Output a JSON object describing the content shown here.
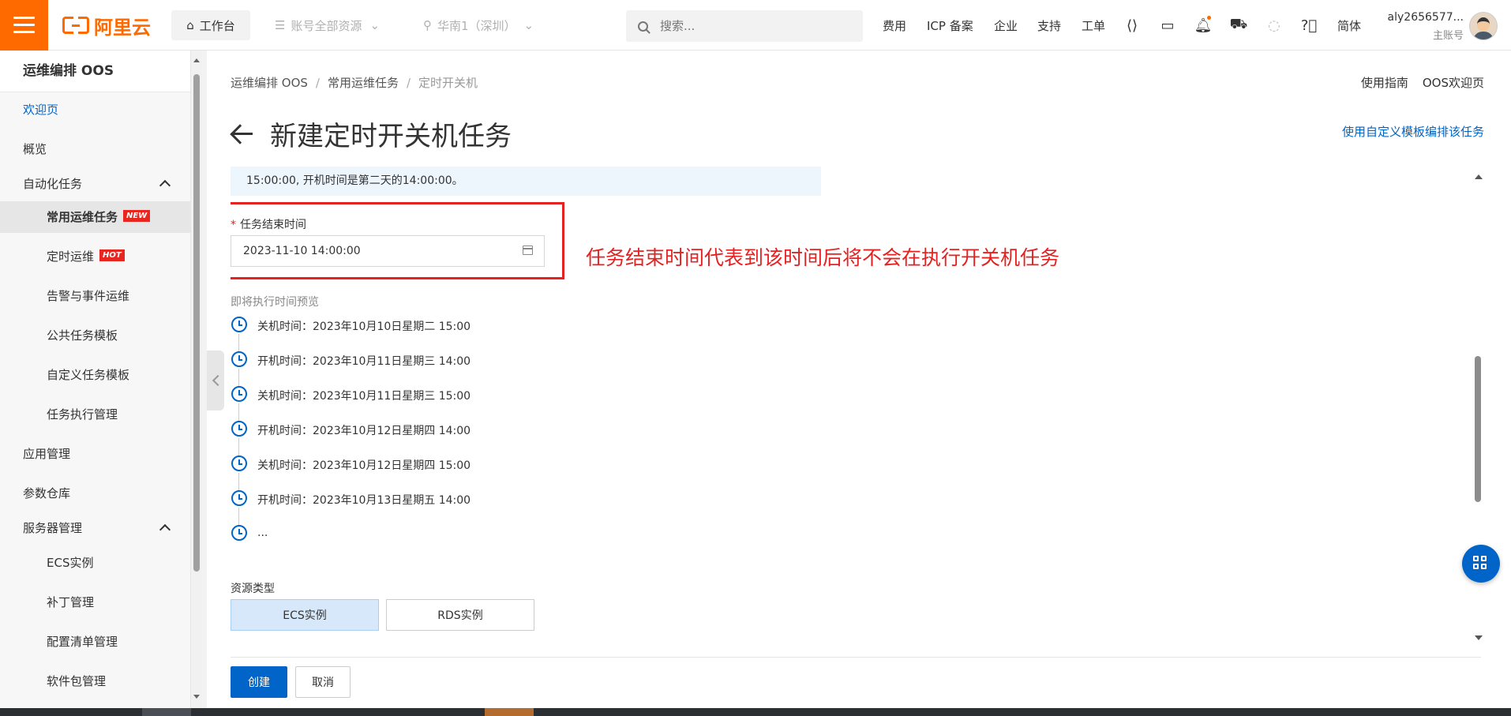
{
  "header": {
    "logo_text": "阿里云",
    "workbench": "工作台",
    "resource_group": "账号全部资源",
    "region": "华南1（深圳）",
    "search_placeholder": "搜索...",
    "links": [
      "费用",
      "ICP 备案",
      "企业",
      "支持",
      "工单"
    ],
    "language": "简体",
    "user_name": "aly2656577...",
    "user_role": "主账号"
  },
  "sidebar": {
    "title": "运维编排 OOS",
    "items": [
      {
        "label": "欢迎页"
      },
      {
        "label": "概览"
      },
      {
        "label": "自动化任务"
      },
      {
        "label": "常用运维任务",
        "badge": "NEW"
      },
      {
        "label": "定时运维",
        "badge": "HOT"
      },
      {
        "label": "告警与事件运维"
      },
      {
        "label": "公共任务模板"
      },
      {
        "label": "自定义任务模板"
      },
      {
        "label": "任务执行管理"
      },
      {
        "label": "应用管理"
      },
      {
        "label": "参数仓库"
      },
      {
        "label": "服务器管理"
      },
      {
        "label": "ECS实例"
      },
      {
        "label": "补丁管理"
      },
      {
        "label": "配置清单管理"
      },
      {
        "label": "软件包管理"
      }
    ]
  },
  "breadcrumb": [
    "运维编排 OOS",
    "常用运维任务",
    "定时开关机"
  ],
  "top_links": [
    "使用指南",
    "OOS欢迎页"
  ],
  "page_title": "新建定时开关机任务",
  "custom_template_link": "使用自定义模板编排该任务",
  "info_note": "15:00:00, 开机时间是第二天的14:00:00。",
  "end_time": {
    "required_mark": "*",
    "label": "任务结束时间",
    "value": "2023-11-10 14:00:00"
  },
  "annotation": "任务结束时间代表到该时间后将不会在执行开关机任务",
  "preview": {
    "label": "即将执行时间预览",
    "items": [
      "关机时间：2023年10月10日星期二 15:00",
      "开机时间：2023年10月11日星期三 14:00",
      "关机时间：2023年10月11日星期三 15:00",
      "开机时间：2023年10月12日星期四 14:00",
      "关机时间：2023年10月12日星期四 15:00",
      "开机时间：2023年10月13日星期五 14:00",
      "..."
    ]
  },
  "resource_type": {
    "label": "资源类型",
    "options": [
      "ECS实例",
      "RDS实例"
    ]
  },
  "actions": {
    "create": "创建",
    "cancel": "取消"
  },
  "colors": {
    "brand": "#ff6a00",
    "primary": "#0064c8",
    "annotation": "#e52222"
  }
}
